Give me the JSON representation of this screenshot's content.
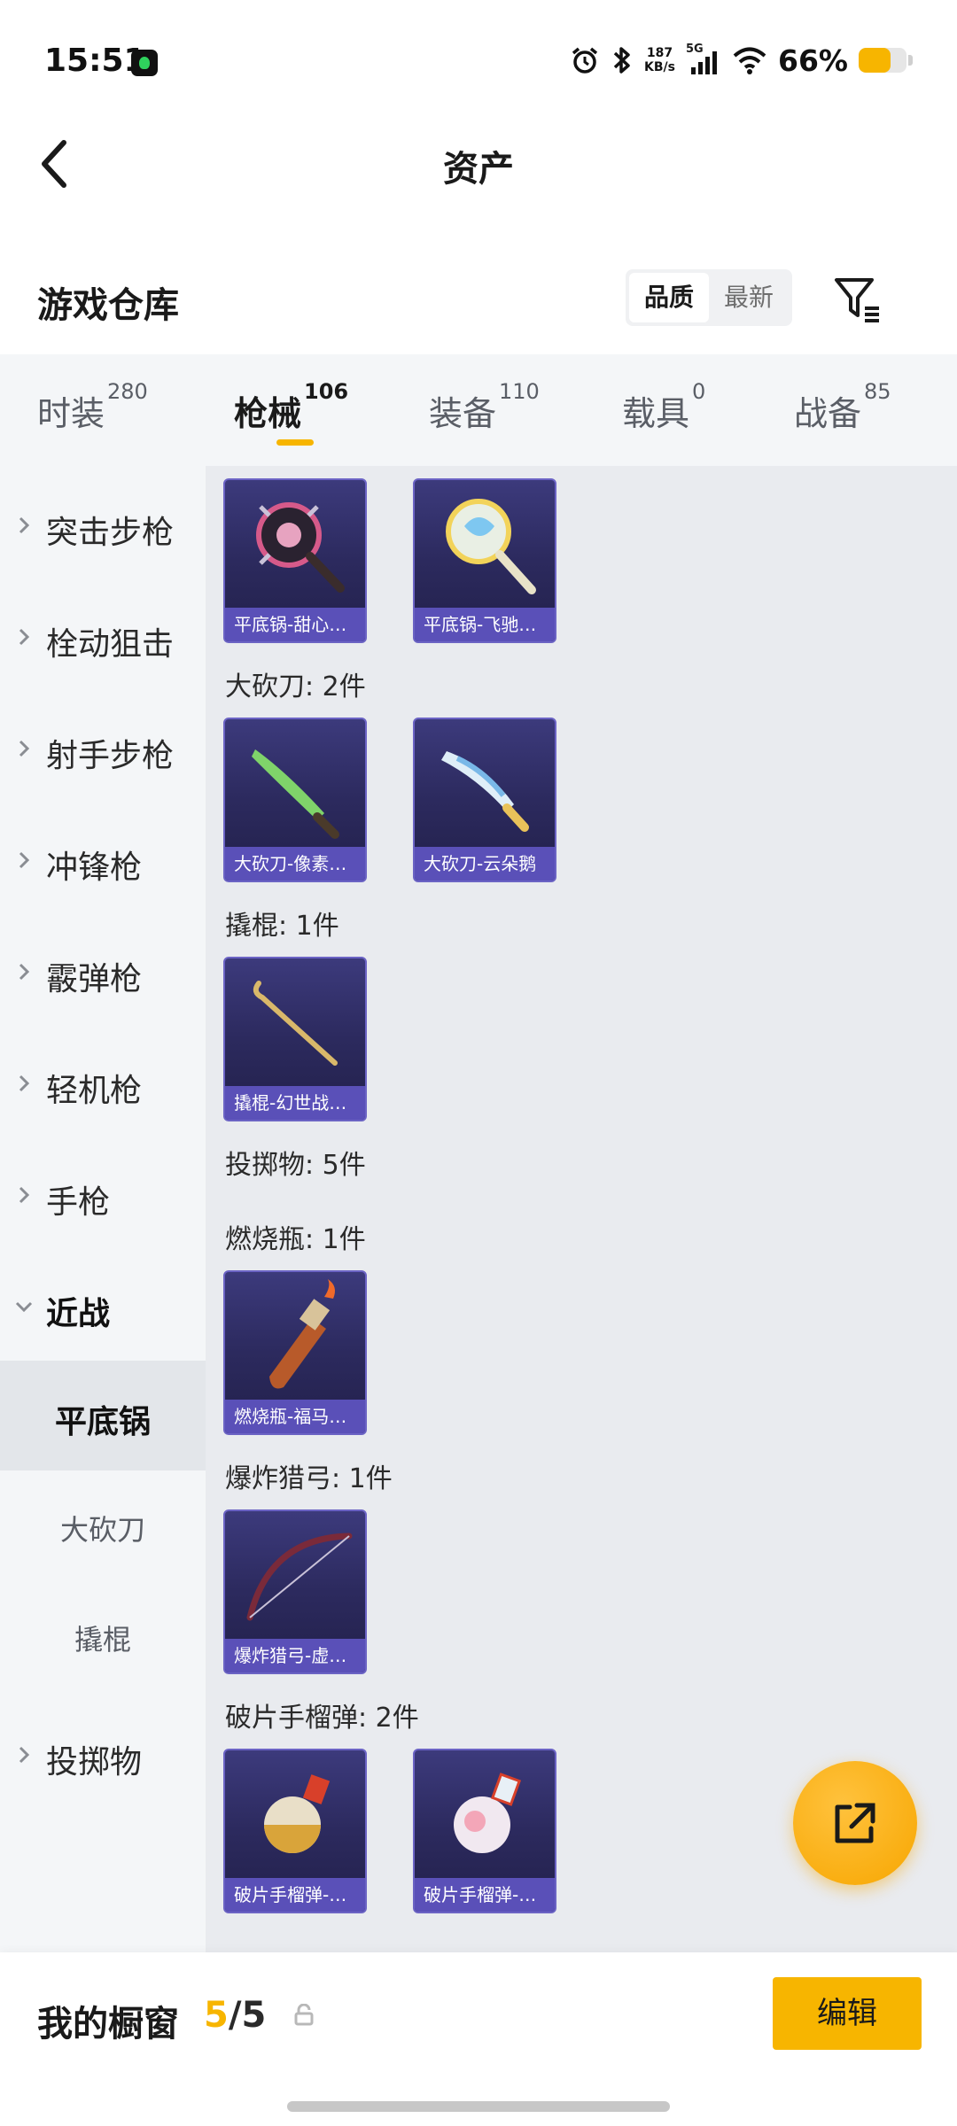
{
  "status_bar": {
    "time": "15:51",
    "net_speed_value": "187",
    "net_speed_unit": "KB/s",
    "network": "5G",
    "battery_percent_label": "66%",
    "battery_level": 0.66,
    "icons": [
      "alarm-icon",
      "bluetooth-icon",
      "signal-icon",
      "wifi-icon",
      "battery-icon"
    ]
  },
  "header": {
    "title": "资产",
    "back_icon": "chevron-left-icon"
  },
  "section": {
    "title": "游戏仓库",
    "sort_options": [
      "品质",
      "最新"
    ],
    "sort_selected": "品质",
    "filter_icon": "filter-icon"
  },
  "tabs": [
    {
      "label": "时装",
      "count": "280",
      "active": false
    },
    {
      "label": "枪械",
      "count": "106",
      "active": true
    },
    {
      "label": "装备",
      "count": "110",
      "active": false
    },
    {
      "label": "载具",
      "count": "0",
      "active": false
    },
    {
      "label": "战备",
      "count": "85",
      "active": false
    }
  ],
  "sidebar": {
    "categories": [
      {
        "label": "突击步枪",
        "expanded": false
      },
      {
        "label": "栓动狙击",
        "expanded": false
      },
      {
        "label": "射手步枪",
        "expanded": false
      },
      {
        "label": "冲锋枪",
        "expanded": false
      },
      {
        "label": "霰弹枪",
        "expanded": false
      },
      {
        "label": "轻机枪",
        "expanded": false
      },
      {
        "label": "手枪",
        "expanded": false
      },
      {
        "label": "近战",
        "expanded": true
      },
      {
        "label": "投掷物",
        "expanded": false
      }
    ],
    "subcategories": [
      {
        "label": "平底锅",
        "active": true
      },
      {
        "label": "大砍刀",
        "active": false
      },
      {
        "label": "撬棍",
        "active": false
      }
    ]
  },
  "content": {
    "items_row_pan": [
      "平底锅-甜心…",
      "平底锅-飞驰…"
    ],
    "group_machete": "大砍刀: 2件",
    "items_machete": [
      "大砍刀-像素…",
      "大砍刀-云朵鹅"
    ],
    "group_crowbar": "撬棍: 1件",
    "items_crowbar": [
      "撬棍-幻世战…"
    ],
    "group_throwables": "投掷物: 5件",
    "group_molotov": "燃烧瓶: 1件",
    "items_molotov": [
      "燃烧瓶-福马…"
    ],
    "group_bow": "爆炸猎弓: 1件",
    "items_bow": [
      "爆炸猎弓-虚…"
    ],
    "group_frag": "破片手榴弹: 2件",
    "items_frag": [
      "破片手榴弹-…",
      "破片手榴弹-…"
    ]
  },
  "fab": {
    "icon": "share-external-icon"
  },
  "bottom_bar": {
    "label": "我的橱窗",
    "used": "5",
    "total": "/5",
    "lock_icon": "lock-icon",
    "edit_label": "编辑"
  },
  "colors": {
    "accent": "#f7b500",
    "card_bg": "#2c2a5e",
    "card_label_bg": "#5a50b8",
    "sidebar_bg": "#f4f6f8",
    "content_bg": "#e9ebef"
  }
}
